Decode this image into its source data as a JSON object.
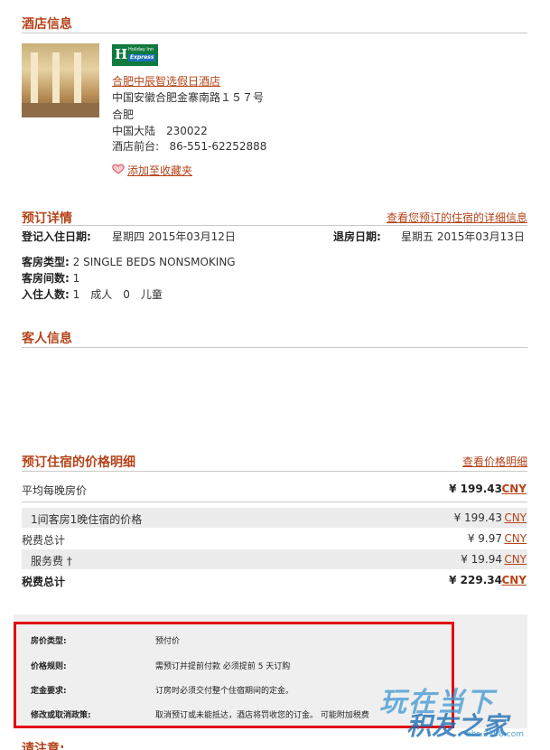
{
  "hotel_section": {
    "title": "酒店信息",
    "logo": {
      "line1": "Holiday Inn",
      "line2": "Express",
      "mark": "H"
    },
    "name": "合肥中辰智选假日酒店",
    "address": "中国安徽合肥金寨南路１５７号",
    "city": "合肥",
    "country_zip": "中国大陆　230022",
    "frontdesk_label": "酒店前台:",
    "frontdesk_phone": "86-551-62252888",
    "favorite_link": "添加至收藏夹"
  },
  "booking_section": {
    "title": "预订详情",
    "detail_link": "查看您预订的住宿的详细信息",
    "checkin_label": "登记入住日期:",
    "checkin_value": "星期四 2015年03月12日",
    "checkout_label": "退房日期:",
    "checkout_value": "星期五 2015年03月13日",
    "room_type_label": "客房类型:",
    "room_type_value": "2 SINGLE BEDS NONSMOKING",
    "room_count_label": "客房间数:",
    "room_count_value": "1",
    "guests_label": "入住人数:",
    "guests_value": "1　成人　0　儿童"
  },
  "guest_section": {
    "title": "客人信息"
  },
  "price_section": {
    "title": "预订住宿的价格明细",
    "detail_link": "查看价格明细",
    "rows": [
      {
        "label": "平均每晚房价",
        "amount": "¥ 199.43",
        "currency": "CNY"
      },
      {
        "label": "1间客房1晚住宿的价格",
        "amount": "¥ 199.43",
        "currency": "CNY"
      },
      {
        "label": "税费总计",
        "amount": "¥ 9.97",
        "currency": "CNY"
      },
      {
        "label": "服务费 †",
        "amount": "¥ 19.94",
        "currency": "CNY"
      },
      {
        "label": "税费总计",
        "amount": "¥ 229.34",
        "currency": "CNY"
      }
    ]
  },
  "notice": {
    "rows": [
      {
        "key": "房价类型:",
        "value": "预付价"
      },
      {
        "key": "价格规则:",
        "value": "需预订并提前付款 必须提前 5 天订购"
      },
      {
        "key": "定金要求:",
        "value": "订房时必须交付整个住宿期间的定金。"
      },
      {
        "key": "修改或取消政策:",
        "value": "取消预订或未能抵达，酒店将罚收您的订金。 可能附加税费"
      }
    ]
  },
  "next_section": {
    "title": "请注意:"
  },
  "watermark": {
    "line1": "玩在当下",
    "line2": "积友之家",
    "url": "bbs.3798.com"
  },
  "colors": {
    "accent": "#b5441b",
    "highlight_box": "#e10b0b",
    "shade": "#ececec"
  }
}
